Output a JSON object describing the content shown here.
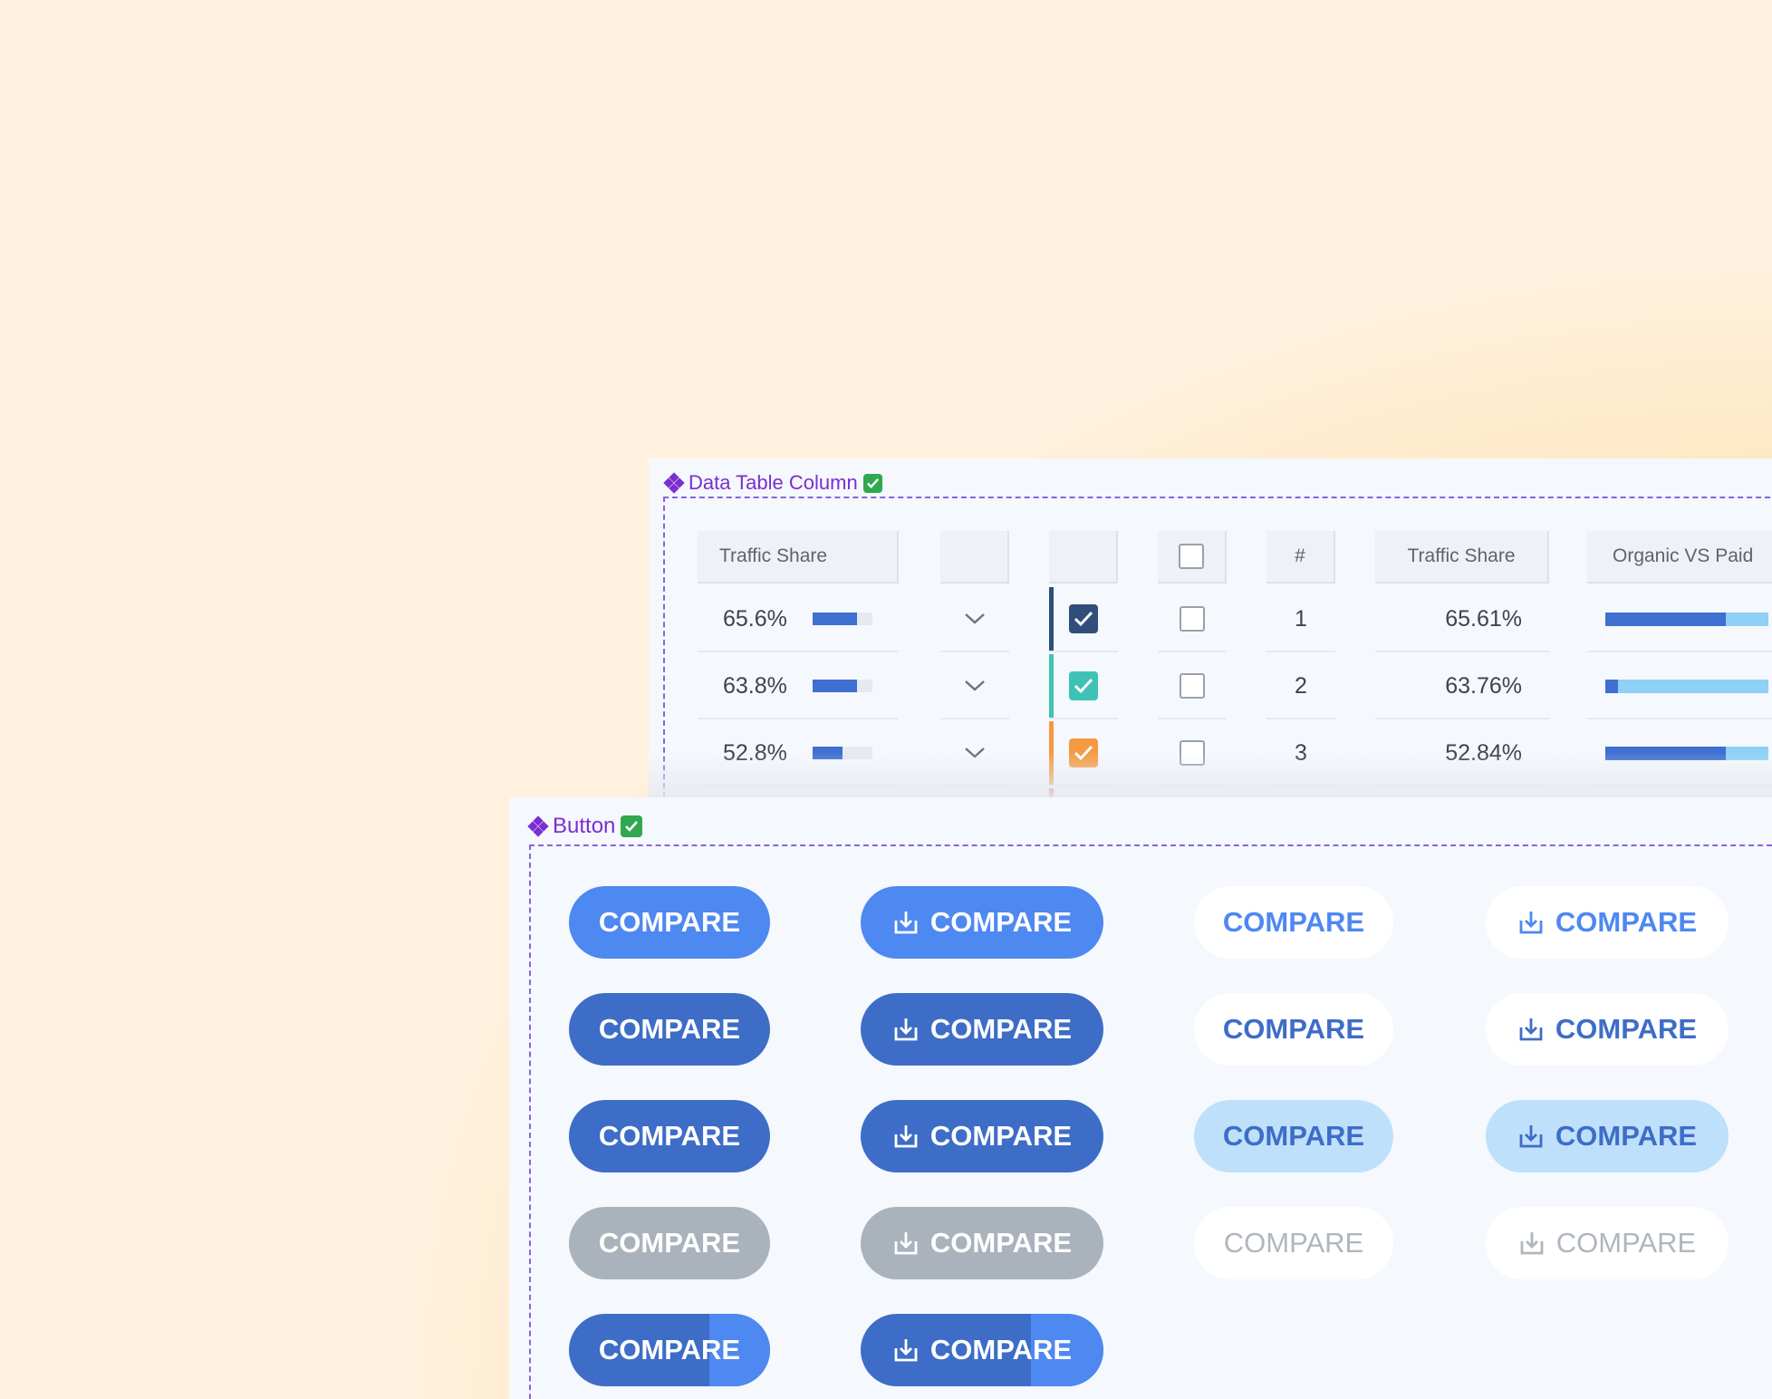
{
  "table_panel": {
    "title": "Data Table Column",
    "headers": [
      "Traffic Share",
      "",
      "",
      "",
      "#",
      "Traffic Share",
      "Organic VS Paid"
    ],
    "rows": [
      {
        "share_label": "65.6%",
        "share_fill": 0.75,
        "checked_color": "#2f4f7a",
        "rank": "1",
        "share_precise": "65.61%",
        "organic_fraction": 0.74
      },
      {
        "share_label": "63.8%",
        "share_fill": 0.75,
        "checked_color": "#3fc2b6",
        "rank": "2",
        "share_precise": "63.76%",
        "organic_fraction": 0.08
      },
      {
        "share_label": "52.8%",
        "share_fill": 0.5,
        "checked_color": "#f59a42",
        "rank": "3",
        "share_precise": "52.84%",
        "organic_fraction": 0.74
      }
    ]
  },
  "button_panel": {
    "title": "Button",
    "button_label": "COMPARE",
    "download_icon": "download-icon",
    "rows": [
      {
        "state": "primary",
        "split_fraction": 0
      },
      {
        "state": "hover",
        "split_fraction": 0
      },
      {
        "state": "active",
        "split_fraction": 0
      },
      {
        "state": "disabled",
        "split_fraction": 0
      },
      {
        "state": "loading",
        "split_fraction": 0.3
      }
    ]
  },
  "colors": {
    "component_purple": "#7b2fd0",
    "primary_blue": "#4e88f1",
    "dark_blue": "#3d6dc7",
    "light_blue": "#bfe0fa",
    "disabled_gray": "#aab2bb"
  }
}
